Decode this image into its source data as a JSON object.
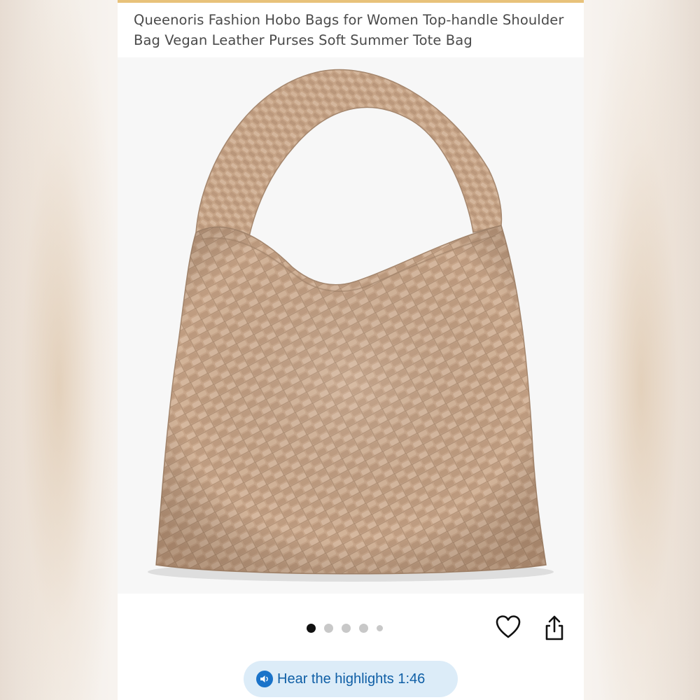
{
  "product": {
    "title": "Queenoris Fashion Hobo Bags for Women Top-handle Shoulder Bag Vegan Leather Purses Soft Summer Tote Bag"
  },
  "gallery": {
    "image_name": "woven-hobo-bag-photo",
    "image_count": 5,
    "active_index": 0
  },
  "actions": {
    "favorite_icon": "heart-icon",
    "share_icon": "share-icon"
  },
  "highlights": {
    "icon": "audio-speaker-icon",
    "label": "Hear the highlights 1:46"
  },
  "colors": {
    "accent_top": "#e8c27a",
    "highlights_bg": "#dcecf8",
    "highlights_text": "#0f5fa6",
    "bag_tan": "#c8a68a"
  }
}
